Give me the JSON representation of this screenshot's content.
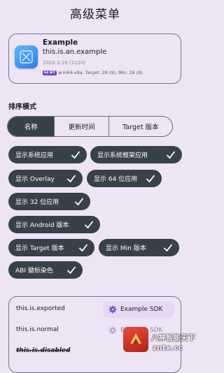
{
  "page_title": "高级菜单",
  "app": {
    "name": "Example",
    "package": "this.is.an.example",
    "version": "2020.3.19 (1120)",
    "abi_tag": "64 BIT",
    "meta": "arm64-v8a, Target: 28 (9),  Min: 28 (9)"
  },
  "sort": {
    "label": "排序模式",
    "options": [
      "名称",
      "更新时间",
      "Target 版本"
    ],
    "selected": "名称"
  },
  "chips": [
    "显示系统应用",
    "显示系统框架应用",
    "显示 Overlay",
    "显示 64 位应用",
    "显示 32 位应用",
    "显示 Android 版本",
    "显示 Target 版本",
    "显示 Min 版本",
    "ABI 徽标染色"
  ],
  "list": {
    "rows": [
      {
        "label": "this.is.exported",
        "button": "Example SDK"
      },
      {
        "label": "this.is.normal",
        "button": "Example SDK"
      },
      {
        "label": "this.is.disabled",
        "button": ""
      }
    ]
  },
  "watermark": {
    "line1": "八神智能天下",
    "line2": "zntx.cc"
  },
  "colors": {
    "background": "#EDE4F6",
    "chip": "#394148",
    "accent": "#6C4BC4",
    "sdk_button": "#E6D9F4"
  },
  "icons": {
    "check": "check-icon",
    "sdk": "gear-icon",
    "app": "app-icon"
  }
}
